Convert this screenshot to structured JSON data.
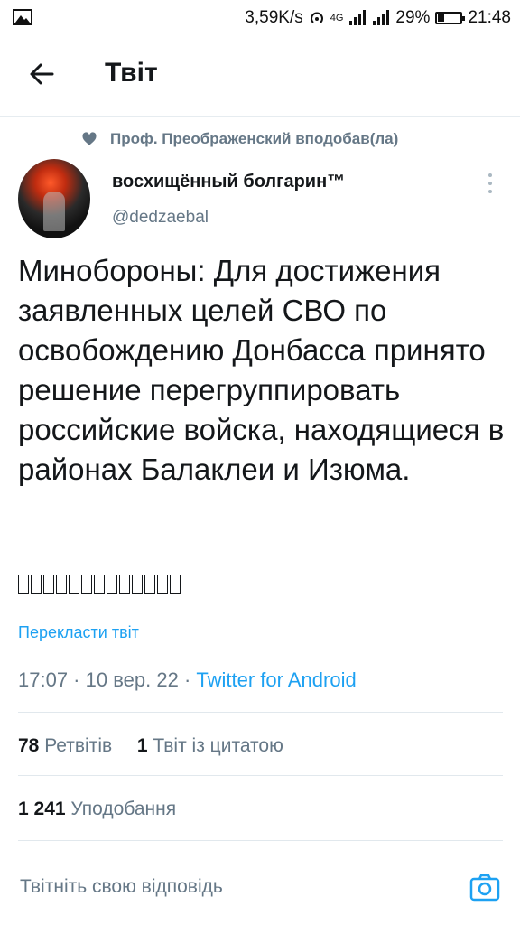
{
  "status_bar": {
    "network_speed": "3,59K/s",
    "network_type": "4G",
    "battery_percent": "29%",
    "battery_level": 0.29,
    "time": "21:48"
  },
  "header": {
    "title": "Твіт"
  },
  "social_context": {
    "text": "Проф. Преображенский вподобав(ла)"
  },
  "author": {
    "name": "восхищённый болгарин™",
    "handle": "@dedzaebal"
  },
  "tweet": {
    "text": "Минобороны: Для достижения заявленных целей СВО по освобождению Донбасса принято решение перегруппировать российские войска, находящиеся в районах Балаклеи и Изюма.",
    "unrendered_glyph_count": 13,
    "translate_label": "Перекласти твіт",
    "time": "17:07",
    "date": "10 вер. 22",
    "source": "Twitter for Android"
  },
  "stats": {
    "retweets_count": "78",
    "retweets_label": "Ретвітів",
    "quotes_count": "1",
    "quotes_label": "Твіт із цитатою",
    "likes_count": "1 241",
    "likes_label": "Уподобання"
  },
  "reply": {
    "placeholder": "Твітніть свою відповідь"
  },
  "colors": {
    "accent": "#1da1f2",
    "secondary_text": "#657786",
    "primary_text": "#14171a"
  }
}
